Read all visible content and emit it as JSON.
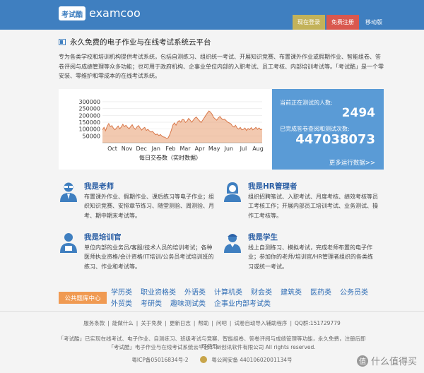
{
  "header": {
    "logo_box": "考试酷",
    "logo_text": "examcoo",
    "nav": {
      "login": "现在登录",
      "register": "免费注册",
      "mobile": "移动版"
    }
  },
  "title": "永久免费的电子作业与在线考试系统云平台",
  "intro": "专为各类学校和培训机构提供考试系统，包括自测练习、组织统一考试、开展知识竞赛、布置课外作业或假期作业、智能组卷、答卷评阅与成绩管理等众多功能；也可用于政府机构、企事业单位内部的入职考试、员工考核、内部培训考试等。「考试酷」是一个零安装、零维护和零成本的在线考试系统。",
  "stats": {
    "online_label": "当前正在测试的人数:",
    "online_value": "2494",
    "completed_label": "已完成答卷查阅和测试次数:",
    "completed_value": "447038073",
    "more_link": "更多运行数据>>",
    "caption": "每日交卷数（实时数据）"
  },
  "chart_data": {
    "type": "area",
    "title": "",
    "xlabel": "每日交卷数（实时数据）",
    "ylabel": "",
    "ylim": [
      0,
      300000
    ],
    "yticks": [
      50000,
      100000,
      150000,
      200000,
      250000,
      300000
    ],
    "x_labels": [
      "Oct",
      "Nov",
      "Dec",
      "Jan",
      "Feb",
      "Mar",
      "Apr",
      "May",
      "Jun",
      "Jul",
      "Aug"
    ],
    "color": "#e89d70",
    "series": [
      {
        "values": [
          95000,
          112000,
          88000,
          120000,
          140000,
          118000,
          125000,
          106000,
          95000,
          108000,
          122000,
          102000,
          115000,
          135000,
          118000,
          128000,
          112000,
          102000,
          118000,
          132000,
          110000,
          98000,
          115000,
          125000,
          108000,
          92000,
          105000,
          112000,
          90000,
          98000,
          86000,
          78000,
          82000,
          70000,
          58000,
          64000,
          52000,
          60000,
          48000,
          42000,
          40000,
          30000,
          36000,
          60000,
          92000,
          130000,
          145000,
          128000,
          152000,
          162000,
          150000,
          170000,
          168000,
          148000,
          158000,
          178000,
          165000,
          150000,
          165000,
          180000,
          188000,
          172000,
          160000,
          148000,
          165000,
          182000,
          200000,
          218000,
          232000,
          224000,
          208000,
          185000,
          175000,
          165000,
          182000,
          192000,
          178000,
          168000,
          172000,
          162000,
          150000,
          145000,
          138000,
          122000,
          115000,
          128000,
          108000,
          100000,
          112000,
          94000,
          98000,
          108000,
          90000,
          104000,
          96000,
          110000,
          94000,
          102000,
          112000,
          98000,
          108000,
          95000,
          100000
        ]
      }
    ]
  },
  "roles": [
    {
      "name": "我是老师",
      "desc": "布置课外作业、假期作业、课后练习等电子作业；组织知识竞赛、安排章节练习、随堂测验、周测验、月考、期中期末考试等。"
    },
    {
      "name": "我是HR管理者",
      "desc": "组织招聘笔试、入职考试、月度考核、绩效考核等员工考核工作；开展内部员工培训考试、业务测试、操作工考核等。"
    },
    {
      "name": "我是培训官",
      "desc": "单位内部的业务员/客服/技术人员的培训考试；各种医师执业资格/会计资格/IT培训/公务员考试培训班的练习、作业和考试等。"
    },
    {
      "name": "我是学生",
      "desc": "线上自测练习、模拟考试，完成老师布置的电子作业；参加你的老师/培训官/HR管理者组织的各类练习或统一考试。"
    }
  ],
  "categories": {
    "button": "公共题库中心",
    "line1": [
      "学历类",
      "职业资格类",
      "外语类",
      "计算机类",
      "财会类",
      "建筑类",
      "医药类",
      "公务员类"
    ],
    "line2": [
      "外贸类",
      "考研类",
      "趣味测试类",
      "企事业内部考试类"
    ]
  },
  "footer": {
    "links": [
      "服务条款",
      "能做什么",
      "关于免费",
      "更新日志",
      "帮助",
      "问吧",
      "试卷自动导入辅助程序",
      "QQ群:151729779"
    ],
    "line1": "「考试酷」已实现在线考试、电子作业、自测练习、班级考试与竞赛、智能组卷、答卷评阅与成绩管理等功能，永久免费，注册后即可使用。",
    "line2": "「考试酷」电子作业与在线考试系统云平台    广州创讯软件有限公司 All rights reserved.",
    "icp": "粤ICP备05016834号-2",
    "police": "粤公网安备 44010602001134号"
  },
  "watermark": "什么值得买"
}
